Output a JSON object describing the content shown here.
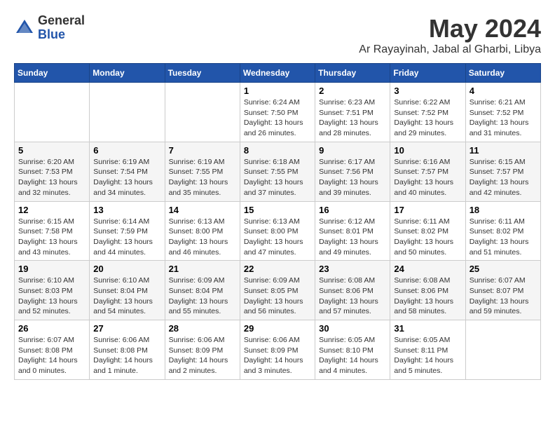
{
  "header": {
    "logo_general": "General",
    "logo_blue": "Blue",
    "title": "May 2024",
    "location": "Ar Rayayinah, Jabal al Gharbi, Libya"
  },
  "days_of_week": [
    "Sunday",
    "Monday",
    "Tuesday",
    "Wednesday",
    "Thursday",
    "Friday",
    "Saturday"
  ],
  "weeks": [
    [
      {
        "day": "",
        "info": ""
      },
      {
        "day": "",
        "info": ""
      },
      {
        "day": "",
        "info": ""
      },
      {
        "day": "1",
        "info": "Sunrise: 6:24 AM\nSunset: 7:50 PM\nDaylight: 13 hours and 26 minutes."
      },
      {
        "day": "2",
        "info": "Sunrise: 6:23 AM\nSunset: 7:51 PM\nDaylight: 13 hours and 28 minutes."
      },
      {
        "day": "3",
        "info": "Sunrise: 6:22 AM\nSunset: 7:52 PM\nDaylight: 13 hours and 29 minutes."
      },
      {
        "day": "4",
        "info": "Sunrise: 6:21 AM\nSunset: 7:52 PM\nDaylight: 13 hours and 31 minutes."
      }
    ],
    [
      {
        "day": "5",
        "info": "Sunrise: 6:20 AM\nSunset: 7:53 PM\nDaylight: 13 hours and 32 minutes."
      },
      {
        "day": "6",
        "info": "Sunrise: 6:19 AM\nSunset: 7:54 PM\nDaylight: 13 hours and 34 minutes."
      },
      {
        "day": "7",
        "info": "Sunrise: 6:19 AM\nSunset: 7:55 PM\nDaylight: 13 hours and 35 minutes."
      },
      {
        "day": "8",
        "info": "Sunrise: 6:18 AM\nSunset: 7:55 PM\nDaylight: 13 hours and 37 minutes."
      },
      {
        "day": "9",
        "info": "Sunrise: 6:17 AM\nSunset: 7:56 PM\nDaylight: 13 hours and 39 minutes."
      },
      {
        "day": "10",
        "info": "Sunrise: 6:16 AM\nSunset: 7:57 PM\nDaylight: 13 hours and 40 minutes."
      },
      {
        "day": "11",
        "info": "Sunrise: 6:15 AM\nSunset: 7:57 PM\nDaylight: 13 hours and 42 minutes."
      }
    ],
    [
      {
        "day": "12",
        "info": "Sunrise: 6:15 AM\nSunset: 7:58 PM\nDaylight: 13 hours and 43 minutes."
      },
      {
        "day": "13",
        "info": "Sunrise: 6:14 AM\nSunset: 7:59 PM\nDaylight: 13 hours and 44 minutes."
      },
      {
        "day": "14",
        "info": "Sunrise: 6:13 AM\nSunset: 8:00 PM\nDaylight: 13 hours and 46 minutes."
      },
      {
        "day": "15",
        "info": "Sunrise: 6:13 AM\nSunset: 8:00 PM\nDaylight: 13 hours and 47 minutes."
      },
      {
        "day": "16",
        "info": "Sunrise: 6:12 AM\nSunset: 8:01 PM\nDaylight: 13 hours and 49 minutes."
      },
      {
        "day": "17",
        "info": "Sunrise: 6:11 AM\nSunset: 8:02 PM\nDaylight: 13 hours and 50 minutes."
      },
      {
        "day": "18",
        "info": "Sunrise: 6:11 AM\nSunset: 8:02 PM\nDaylight: 13 hours and 51 minutes."
      }
    ],
    [
      {
        "day": "19",
        "info": "Sunrise: 6:10 AM\nSunset: 8:03 PM\nDaylight: 13 hours and 52 minutes."
      },
      {
        "day": "20",
        "info": "Sunrise: 6:10 AM\nSunset: 8:04 PM\nDaylight: 13 hours and 54 minutes."
      },
      {
        "day": "21",
        "info": "Sunrise: 6:09 AM\nSunset: 8:04 PM\nDaylight: 13 hours and 55 minutes."
      },
      {
        "day": "22",
        "info": "Sunrise: 6:09 AM\nSunset: 8:05 PM\nDaylight: 13 hours and 56 minutes."
      },
      {
        "day": "23",
        "info": "Sunrise: 6:08 AM\nSunset: 8:06 PM\nDaylight: 13 hours and 57 minutes."
      },
      {
        "day": "24",
        "info": "Sunrise: 6:08 AM\nSunset: 8:06 PM\nDaylight: 13 hours and 58 minutes."
      },
      {
        "day": "25",
        "info": "Sunrise: 6:07 AM\nSunset: 8:07 PM\nDaylight: 13 hours and 59 minutes."
      }
    ],
    [
      {
        "day": "26",
        "info": "Sunrise: 6:07 AM\nSunset: 8:08 PM\nDaylight: 14 hours and 0 minutes."
      },
      {
        "day": "27",
        "info": "Sunrise: 6:06 AM\nSunset: 8:08 PM\nDaylight: 14 hours and 1 minute."
      },
      {
        "day": "28",
        "info": "Sunrise: 6:06 AM\nSunset: 8:09 PM\nDaylight: 14 hours and 2 minutes."
      },
      {
        "day": "29",
        "info": "Sunrise: 6:06 AM\nSunset: 8:09 PM\nDaylight: 14 hours and 3 minutes."
      },
      {
        "day": "30",
        "info": "Sunrise: 6:05 AM\nSunset: 8:10 PM\nDaylight: 14 hours and 4 minutes."
      },
      {
        "day": "31",
        "info": "Sunrise: 6:05 AM\nSunset: 8:11 PM\nDaylight: 14 hours and 5 minutes."
      },
      {
        "day": "",
        "info": ""
      }
    ]
  ]
}
